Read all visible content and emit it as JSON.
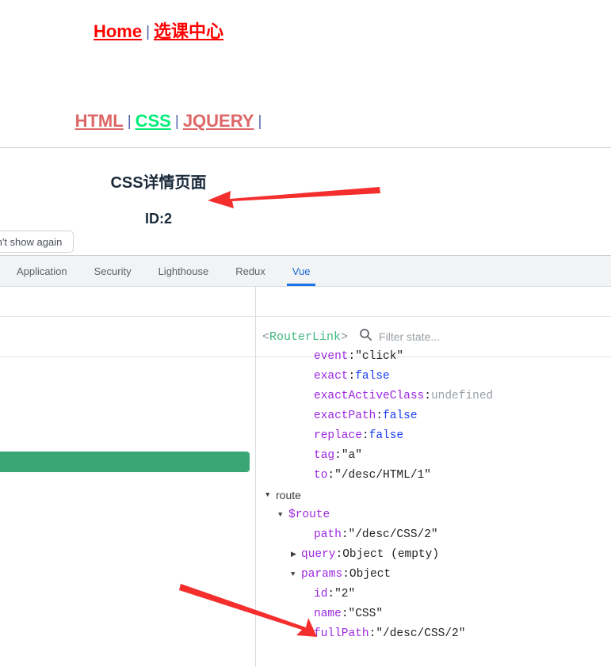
{
  "page": {
    "primary_nav": {
      "home_label": "Home",
      "separator": "|",
      "course_center_label": "选课中心"
    },
    "secondary_nav": {
      "html_label": "HTML",
      "css_label": "CSS",
      "jquery_label": "JQUERY",
      "separator": "|",
      "trailing_separator": "|"
    },
    "detail": {
      "title": "CSS详情页面",
      "id_text": "ID:2"
    },
    "dont_show_again_label": "Don't show again"
  },
  "devtools": {
    "tabs": [
      {
        "label": "Application",
        "active": false
      },
      {
        "label": "Security",
        "active": false
      },
      {
        "label": "Lighthouse",
        "active": false
      },
      {
        "label": "Redux",
        "active": false
      },
      {
        "label": "Vue",
        "active": true
      }
    ],
    "state_panel": {
      "inspected_open": "<",
      "inspected_component": "RouterLink",
      "inspected_close": ">",
      "search_icon": "search-icon",
      "filter_placeholder": "Filter state...",
      "filter_value": "",
      "rows": [
        {
          "indent": 3,
          "arrow": "",
          "key": "event",
          "key_style": "prop",
          "sep": ": ",
          "value": "\"click\"",
          "value_style": "str"
        },
        {
          "indent": 3,
          "arrow": "",
          "key": "exact",
          "key_style": "prop",
          "sep": ": ",
          "value": "false",
          "value_style": "bool"
        },
        {
          "indent": 3,
          "arrow": "",
          "key": "exactActiveClass",
          "key_style": "prop",
          "sep": ": ",
          "value": "undefined",
          "value_style": "undef"
        },
        {
          "indent": 3,
          "arrow": "",
          "key": "exactPath",
          "key_style": "prop",
          "sep": ": ",
          "value": "false",
          "value_style": "bool"
        },
        {
          "indent": 3,
          "arrow": "",
          "key": "replace",
          "key_style": "prop",
          "sep": ": ",
          "value": "false",
          "value_style": "bool"
        },
        {
          "indent": 3,
          "arrow": "",
          "key": "tag",
          "key_style": "prop",
          "sep": ": ",
          "value": "\"a\"",
          "value_style": "str"
        },
        {
          "indent": 3,
          "arrow": "",
          "key": "to",
          "key_style": "prop",
          "sep": ": ",
          "value": "\"/desc/HTML/1\"",
          "value_style": "str"
        },
        {
          "indent": 0,
          "arrow": "▼",
          "key": "route",
          "key_style": "group",
          "sep": "",
          "value": "",
          "value_style": "none"
        },
        {
          "indent": 1,
          "arrow": "▼",
          "key": "$route",
          "key_style": "prop",
          "sep": "",
          "value": "",
          "value_style": "none"
        },
        {
          "indent": 3,
          "arrow": "",
          "key": "path",
          "key_style": "prop",
          "sep": ": ",
          "value": "\"/desc/CSS/2\"",
          "value_style": "str"
        },
        {
          "indent": 2,
          "arrow": "▶",
          "key": "query",
          "key_style": "prop",
          "sep": ": ",
          "value": "Object (empty)",
          "value_style": "obj"
        },
        {
          "indent": 2,
          "arrow": "▼",
          "key": "params",
          "key_style": "prop",
          "sep": ": ",
          "value": "Object",
          "value_style": "obj"
        },
        {
          "indent": 3,
          "arrow": "",
          "key": "id",
          "key_style": "prop",
          "sep": ": ",
          "value": "\"2\"",
          "value_style": "str"
        },
        {
          "indent": 3,
          "arrow": "",
          "key": "name",
          "key_style": "prop",
          "sep": ": ",
          "value": "\"CSS\"",
          "value_style": "str"
        },
        {
          "indent": 3,
          "arrow": "",
          "key": "fullPath",
          "key_style": "prop",
          "sep": ": ",
          "value": "\"/desc/CSS/2\"",
          "value_style": "str"
        }
      ]
    }
  },
  "colors": {
    "nav_red": "#ff0000",
    "nav_muted_red": "#dd6666",
    "nav_active_green": "#00ee77",
    "vue_green": "#42b883",
    "selected_component_green": "#39a675",
    "tab_active_blue": "#1a73e8",
    "annotation_red": "#f42d2d",
    "prop_purple": "#9c27e0",
    "bool_blue": "#1a3df0"
  },
  "annotations": [
    {
      "name": "arrow-to-detail-title",
      "direction": "left"
    },
    {
      "name": "arrow-to-params-id",
      "direction": "down-right"
    }
  ]
}
